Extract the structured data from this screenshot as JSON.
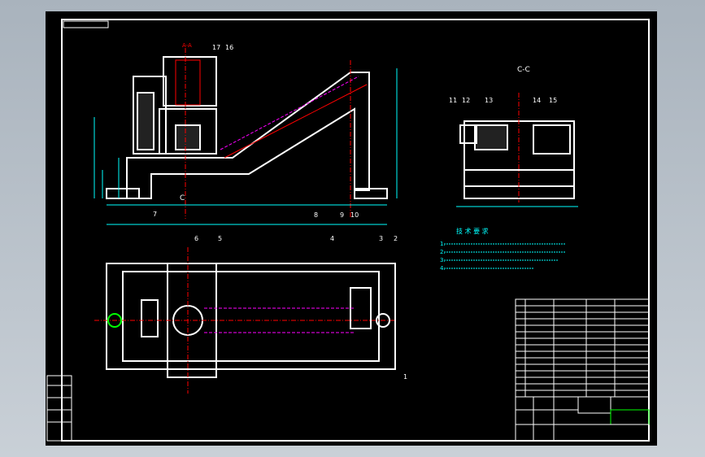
{
  "drawing": {
    "colors": {
      "paper": "#000000",
      "outline": "#ffffff",
      "dim": "#00ffff",
      "center": "#ff0000",
      "hidden": "#ff00ff",
      "note": "#00ffff",
      "title": "#00ff00",
      "label": "#ffff00"
    },
    "section_a_label": "A-A",
    "section_c_label": "C-C",
    "section_c_mark": "C",
    "balloons_front": [
      "17",
      "16",
      "7",
      "8",
      "9",
      "10"
    ],
    "balloons_cc": [
      "11",
      "12",
      "13",
      "14",
      "15"
    ],
    "balloons_plan": [
      "6",
      "5",
      "4",
      "3",
      "2",
      "1"
    ],
    "tech_title": "技 术 要 求",
    "tech_lines": [
      "1.",
      "2.",
      "3.",
      "4."
    ],
    "icons": [
      "gear-housing-icon",
      "fixture-body-icon",
      "plan-view-icon"
    ]
  }
}
